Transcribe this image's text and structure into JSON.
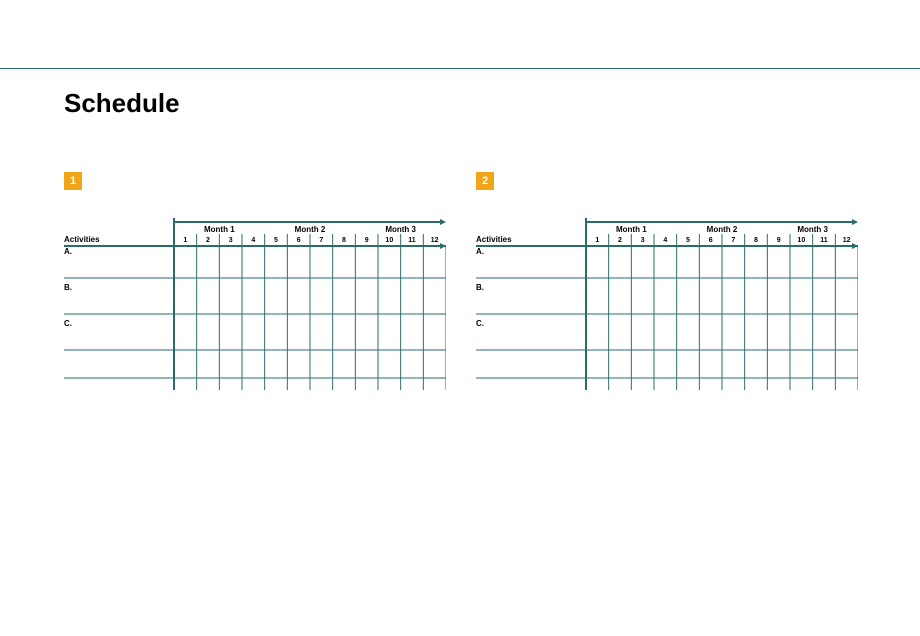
{
  "title": "Schedule",
  "badges": {
    "b1": "1",
    "b2": "2"
  },
  "chart": {
    "axis_label": "Activities",
    "months": [
      "Month 1",
      "Month 2",
      "Month 3"
    ],
    "weeks": [
      "1",
      "2",
      "3",
      "4",
      "5",
      "6",
      "7",
      "8",
      "9",
      "10",
      "11",
      "12"
    ],
    "rows": [
      "A.",
      "B.",
      "C."
    ]
  },
  "chart_data": [
    {
      "type": "table",
      "title": "Schedule 1",
      "columns": {
        "months": [
          "Month 1",
          "Month 2",
          "Month 3"
        ],
        "weeks": [
          1,
          2,
          3,
          4,
          5,
          6,
          7,
          8,
          9,
          10,
          11,
          12
        ]
      },
      "rows": [
        "A.",
        "B.",
        "C."
      ],
      "series": []
    },
    {
      "type": "table",
      "title": "Schedule 2",
      "columns": {
        "months": [
          "Month 1",
          "Month 2",
          "Month 3"
        ],
        "weeks": [
          1,
          2,
          3,
          4,
          5,
          6,
          7,
          8,
          9,
          10,
          11,
          12
        ]
      },
      "rows": [
        "A.",
        "B.",
        "C."
      ],
      "series": []
    }
  ]
}
